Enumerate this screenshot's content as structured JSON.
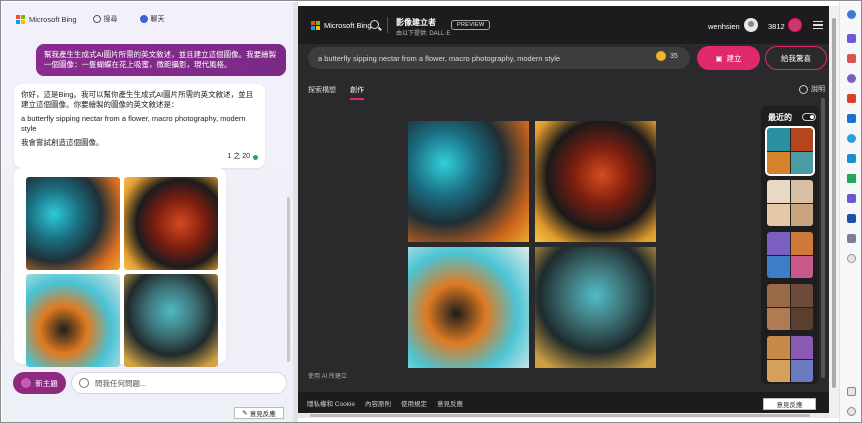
{
  "left_pane": {
    "brand": "Microsoft Bing",
    "tabs": [
      {
        "label": "搜尋",
        "active": false
      },
      {
        "label": "聊天",
        "active": true
      }
    ],
    "user_message": "幫我產生生成式AI圖片所需的英文敘述，並且建立這個圖像。我要繪製一個圖像：一隻蝴蝶在花上吸蜜，微距攝影，現代風格。",
    "bot_message": {
      "intro": "你好，這是Bing。我可以幫你產生生成式AI圖片所需的英文敘述，並且建立這個圖像。你要繪製的圖像的英文敘述是：",
      "prompt": "a butterfly sipping nectar from a flower, macro photography, modern style",
      "outro": "我會嘗試創造這個圖像。",
      "counter": "1 之 20"
    },
    "new_topic_label": "新主題",
    "ask_placeholder": "問我任何問題...",
    "feedback_label": "意見反應"
  },
  "right_pane": {
    "brand": "Microsoft Bing",
    "creator_title": "影像建立者",
    "creator_sub": "由以下提供: DALL·E",
    "preview_badge": "PREVIEW",
    "username": "wenhsien",
    "score": "3812",
    "prompt_text": "a butterfly sipping nectar from a flower, macro photography, modern style",
    "boosts": "35",
    "create_label": "建立",
    "surprise_label": "給我驚喜",
    "tabs": [
      {
        "label": "探索構想",
        "active": false
      },
      {
        "label": "創作",
        "active": true
      }
    ],
    "help_label": "說明",
    "made_with": "使用 AI 所建立",
    "recent_title": "最近的",
    "footer_links": [
      "隱私權和 Cookie",
      "內容原則",
      "使用規定",
      "意見反應"
    ],
    "feedback_label": "意見反應"
  },
  "colors": {
    "accent_pink": "#e0286d",
    "user_bubble": "#8a2b8f",
    "new_topic": "#8d2a7f",
    "online_dot": "#23a45a"
  },
  "icons": [
    "bing-logo-icon",
    "search-icon",
    "chat-icon",
    "user-avatar-icon",
    "trophy-icon",
    "menu-icon",
    "coin-icon",
    "create-icon",
    "help-icon",
    "toggle-icon",
    "broom-icon",
    "feedback-icon"
  ]
}
